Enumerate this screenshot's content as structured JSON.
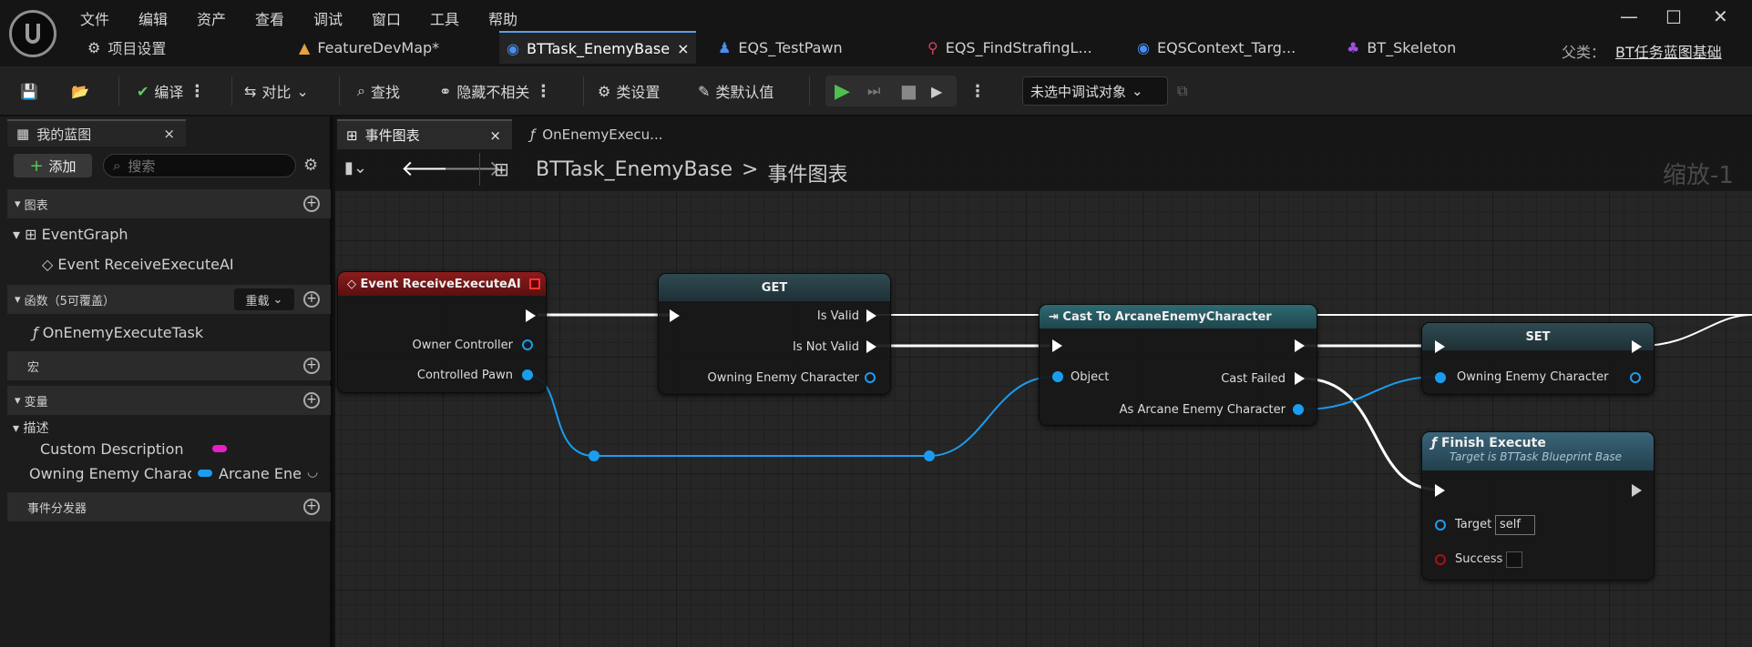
{
  "menu": [
    "文件",
    "编辑",
    "资产",
    "查看",
    "调试",
    "窗口",
    "工具",
    "帮助"
  ],
  "tabs": [
    {
      "label": "项目设置",
      "icon": "gear-icon"
    },
    {
      "label": "FeatureDevMap*",
      "icon": "level-icon"
    },
    {
      "label": "BTTask_EnemyBase",
      "icon": "blueprint-icon",
      "close": "×"
    },
    {
      "label": "EQS_TestPawn",
      "icon": "pawn-icon"
    },
    {
      "label": "EQS_FindStrafingL...",
      "icon": "location-icon"
    },
    {
      "label": "EQSContext_Targ...",
      "icon": "blueprint-icon"
    },
    {
      "label": "BT_Skeleton",
      "icon": "tree-icon"
    }
  ],
  "parent": {
    "label": "父类：",
    "value": "BT任务蓝图基础"
  },
  "toolbar": {
    "compile": "编译",
    "diff": "对比",
    "find": "查找",
    "hide_unrelated": "隐藏不相关",
    "class_settings": "类设置",
    "class_defaults": "类默认值",
    "debug_object": "未选中调试对象"
  },
  "left": {
    "tab": "我的蓝图",
    "tab_close": "×",
    "add": "添加",
    "search_placeholder": "搜索",
    "sections": {
      "graphs": "图表",
      "functions": "函数（5可覆盖）",
      "override": "重载",
      "macros": "宏",
      "variables": "变量",
      "dispatchers": "事件分发器"
    },
    "event_graph": "EventGraph",
    "event_item": "Event ReceiveExecuteAI",
    "function_item": "OnEnemyExecuteTask",
    "var_category": "描述",
    "vars": [
      {
        "name": "Custom Description",
        "color": "#e61fc8"
      },
      {
        "name": "Owning Enemy Charact",
        "type": "Arcane Ener",
        "color": "#1a9df0"
      }
    ]
  },
  "graph": {
    "tabs": [
      {
        "label": "事件图表",
        "close": "×"
      },
      {
        "label": "OnEnemyExecu..."
      }
    ],
    "crumb": {
      "bp": "BTTask_EnemyBase",
      "sep": ">",
      "graph": "事件图表"
    },
    "zoom": "缩放-1",
    "nodes": {
      "event": {
        "title": "Event ReceiveExecuteAI",
        "pins": [
          "Owner Controller",
          "Controlled Pawn"
        ]
      },
      "get": {
        "title": "GET",
        "pins": [
          "Is Valid",
          "Is Not Valid",
          "Owning Enemy Character"
        ]
      },
      "cast": {
        "title": "Cast To ArcaneEnemyCharacter",
        "pins": [
          "Object",
          "Cast Failed",
          "As Arcane Enemy Character"
        ]
      },
      "set": {
        "title": "SET",
        "pins": [
          "Owning Enemy Character"
        ]
      },
      "finish": {
        "title": "Finish Execute",
        "subtitle": "Target is BTTask Blueprint Base",
        "pins": [
          "Target",
          "Success"
        ],
        "target_value": "self"
      }
    }
  }
}
